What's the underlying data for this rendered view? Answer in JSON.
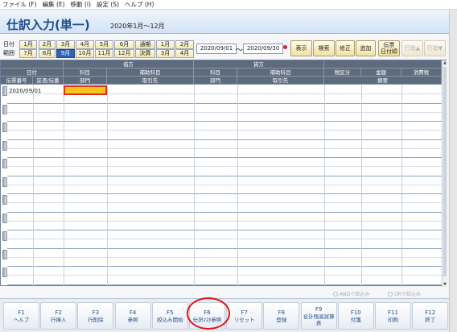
{
  "menu": [
    {
      "label": "ファイル (F)"
    },
    {
      "label": "編集 (E)"
    },
    {
      "label": "移動 (I)"
    },
    {
      "label": "設定 (S)"
    },
    {
      "label": "ヘルプ (H)"
    }
  ],
  "header": {
    "title": "仕訳入力(単一)",
    "period": "2020年1月～12月"
  },
  "month_selector": {
    "label_top": "日付",
    "label_bottom": "範囲",
    "row1": [
      "1月",
      "2月",
      "3月",
      "4月",
      "5月",
      "6月",
      "通期",
      "1月",
      "2月"
    ],
    "row2": [
      "7月",
      "8月",
      "9月",
      "10月",
      "11月",
      "12月",
      "決算",
      "3月",
      "4月"
    ],
    "selected": "9月"
  },
  "date_range": {
    "from": "2020/09/01",
    "to": "2020/09/30",
    "separator": "～"
  },
  "actions": {
    "display": "表示",
    "search": "検索",
    "correct": "修正",
    "add": "追加",
    "voucher_line1": "伝票",
    "voucher_line2": "日付順",
    "prev_line": "行指▲",
    "next_line": "行指▼"
  },
  "grid": {
    "debit": "借方",
    "credit": "貸方",
    "cols_r1": {
      "date": "日付",
      "d_account": "科目",
      "d_sub": "補助科目",
      "c_account": "科目",
      "c_sub": "補助科目",
      "tax": "税区分",
      "amount": "金額",
      "consumption_tax": "消費税"
    },
    "cols_r2": {
      "voucher_no": "伝票番号",
      "evidence_no": "証憑/伝番",
      "d_dept": "部門",
      "d_partner": "取引先",
      "c_dept": "部門",
      "c_partner": "取引先",
      "summary": "摘要"
    },
    "first_row_date": "2020/09/01"
  },
  "filters": {
    "and": "ANDで絞込み",
    "or": "ORで絞込み"
  },
  "function_keys": [
    {
      "key": "F1",
      "label": "ヘルプ"
    },
    {
      "key": "F2",
      "label": "行挿入"
    },
    {
      "key": "F3",
      "label": "行削除"
    },
    {
      "key": "F4",
      "label": "参照"
    },
    {
      "key": "F5",
      "label": "絞込み開始"
    },
    {
      "key": "F6",
      "label": "仕訳ﾏｽﾀ参照"
    },
    {
      "key": "F7",
      "label": "リセット"
    },
    {
      "key": "F8",
      "label": "登録"
    },
    {
      "key": "F9",
      "label": "合計残高試算表"
    },
    {
      "key": "F10",
      "label": "付箋"
    },
    {
      "key": "F11",
      "label": "印刷"
    },
    {
      "key": "F12",
      "label": "終了"
    }
  ],
  "colors": {
    "accent": "#1f4c8f",
    "selected_month": "#2f63b5",
    "header_bg": "#5d6b7d",
    "highlight_circle": "#e01818",
    "active_cell": "#f7c320"
  }
}
